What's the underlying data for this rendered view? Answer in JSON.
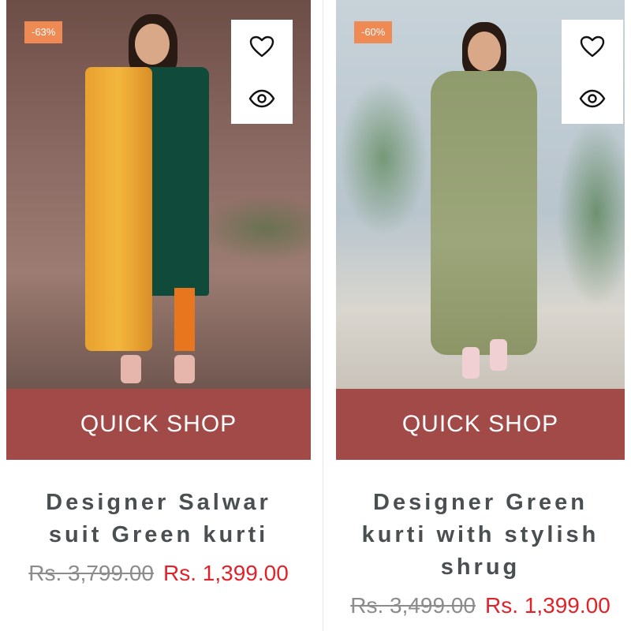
{
  "products": [
    {
      "discount": "-63%",
      "quick_shop": "QUICK SHOP",
      "title_lines": [
        "Designer Salwar",
        "suit Green kurti"
      ],
      "old_price": "Rs. 3,799.00",
      "new_price": "Rs. 1,399.00"
    },
    {
      "discount": "-60%",
      "quick_shop": "QUICK SHOP",
      "title_lines": [
        "Designer Green",
        "kurti with stylish",
        "shrug"
      ],
      "old_price": "Rs. 3,499.00",
      "new_price": "Rs. 1,399.00"
    }
  ],
  "icons": {
    "wishlist": "heart-icon",
    "quick_view": "eye-icon"
  },
  "colors": {
    "accent": "#a24a47",
    "badge": "#f08a55",
    "sale": "#e0232b",
    "title": "#4a4f52"
  }
}
